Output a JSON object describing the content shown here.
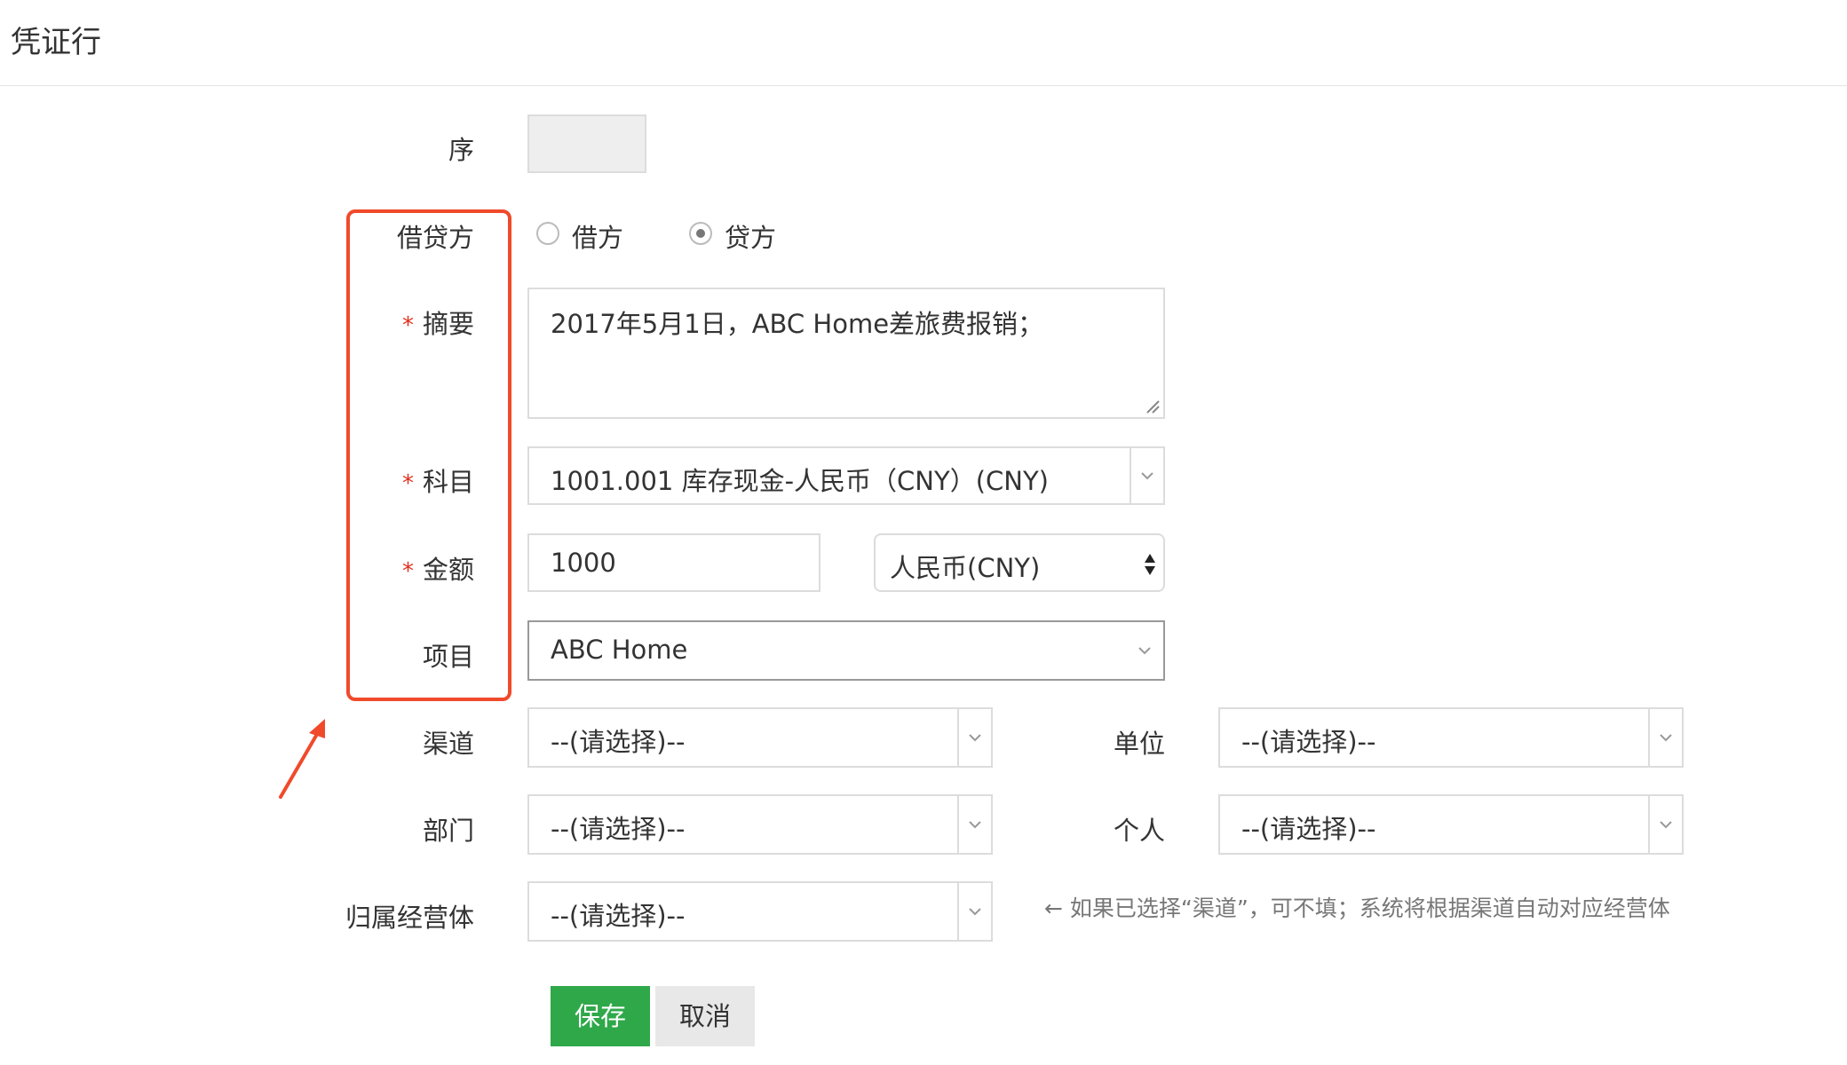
{
  "header": {
    "title": "凭证行"
  },
  "form": {
    "seq": {
      "label": "序",
      "value": ""
    },
    "direction": {
      "label": "借贷方",
      "options": [
        {
          "label": "借方",
          "selected": false
        },
        {
          "label": "贷方",
          "selected": true
        }
      ]
    },
    "summary": {
      "label": "摘要",
      "required_mark": "*",
      "value": "2017年5月1日，ABC Home差旅费报销；"
    },
    "subject": {
      "label": "科目",
      "required_mark": "*",
      "value": "1001.001 库存现金-人民币（CNY）(CNY)"
    },
    "amount": {
      "label": "金额",
      "required_mark": "*",
      "value": "1000",
      "currency": "人民币(CNY)"
    },
    "project": {
      "label": "项目",
      "value": "ABC Home"
    },
    "channel": {
      "label": "渠道",
      "value": "--(请选择)--"
    },
    "unit": {
      "label": "单位",
      "value": "--(请选择)--"
    },
    "department": {
      "label": "部门",
      "value": "--(请选择)--"
    },
    "person": {
      "label": "个人",
      "value": "--(请选择)--"
    },
    "entity": {
      "label": "归属经营体",
      "value": "--(请选择)--"
    },
    "hint": "← 如果已选择“渠道”，可不填；系统将根据渠道自动对应经营体"
  },
  "buttons": {
    "save": "保存",
    "cancel": "取消"
  },
  "colors": {
    "save_bg": "#2fa84a",
    "highlight": "#f04a2b",
    "required": "#e0301e"
  }
}
